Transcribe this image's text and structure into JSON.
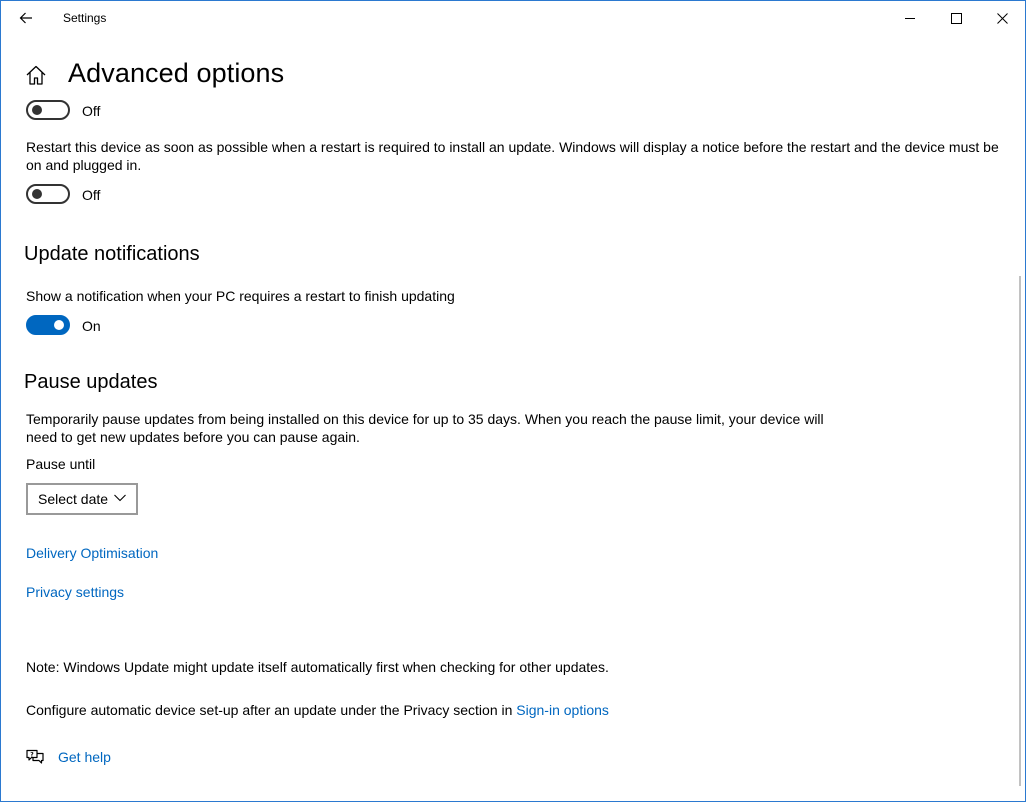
{
  "window": {
    "title": "Settings"
  },
  "header": {
    "title": "Advanced options"
  },
  "toggles": {
    "first": {
      "state_label": "Off",
      "on": false
    },
    "restart": {
      "description": "Restart this device as soon as possible when a restart is required to install an update. Windows will display a notice before the restart and the device must be on and plugged in.",
      "state_label": "Off",
      "on": false
    }
  },
  "update_notifications": {
    "title": "Update notifications",
    "description": "Show a notification when your PC requires a restart to finish updating",
    "state_label": "On",
    "on": true
  },
  "pause_updates": {
    "title": "Pause updates",
    "description": "Temporarily pause updates from being installed on this device for up to 35 days. When you reach the pause limit, your device will need to get new updates before you can pause again.",
    "pause_until_label": "Pause until",
    "select_value": "Select date"
  },
  "links": {
    "delivery": "Delivery Optimisation",
    "privacy": "Privacy settings"
  },
  "notes": {
    "note": "Note: Windows Update might update itself automatically first when checking for other updates.",
    "configure_prefix": "Configure automatic device set-up after an update under the Privacy section in ",
    "configure_link": "Sign-in options"
  },
  "help": {
    "label": "Get help"
  },
  "colors": {
    "accent": "#0067c0",
    "window_border": "#2b79d0"
  },
  "icons": [
    "back-arrow-icon",
    "minimize-icon",
    "maximize-icon",
    "close-icon",
    "home-icon",
    "chevron-down-icon",
    "get-help-icon"
  ]
}
